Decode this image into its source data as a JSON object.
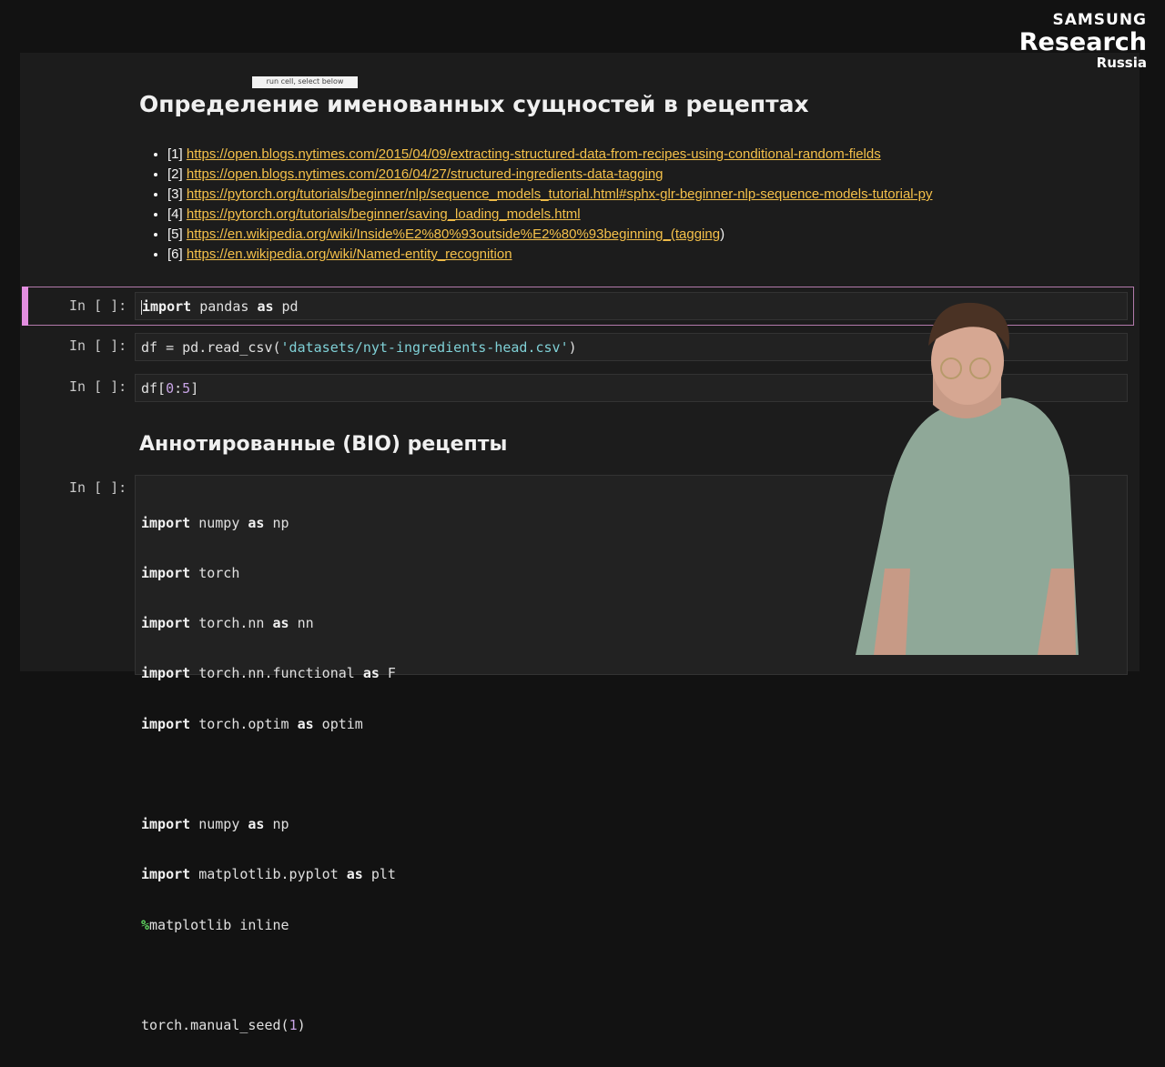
{
  "brand": {
    "line1": "SAMSUNG",
    "line2": "Research",
    "line3": "Russia"
  },
  "tooltip": "run cell, select below",
  "title": "Определение именованных сущностей в рецептах",
  "references": [
    {
      "num": "[1]",
      "url": "https://open.blogs.nytimes.com/2015/04/09/extracting-structured-data-from-recipes-using-conditional-random-fields",
      "suffix": ""
    },
    {
      "num": "[2]",
      "url": "https://open.blogs.nytimes.com/2016/04/27/structured-ingredients-data-tagging",
      "suffix": ""
    },
    {
      "num": "[3]",
      "url": "https://pytorch.org/tutorials/beginner/nlp/sequence_models_tutorial.html#sphx-glr-beginner-nlp-sequence-models-tutorial-py",
      "suffix": ""
    },
    {
      "num": "[4]",
      "url": "https://pytorch.org/tutorials/beginner/saving_loading_models.html",
      "suffix": ""
    },
    {
      "num": "[5]",
      "url": "https://en.wikipedia.org/wiki/Inside%E2%80%93outside%E2%80%93beginning_(tagging",
      "suffix": ")"
    },
    {
      "num": "[6]",
      "url": "https://en.wikipedia.org/wiki/Named-entity_recognition",
      "suffix": ""
    }
  ],
  "prompt": "In [ ]:",
  "cells": {
    "c1": {
      "kw1": "import",
      "mid": " pandas ",
      "kw2": "as",
      "end": " pd"
    },
    "c2": {
      "pre": "df = pd.read_csv(",
      "str": "'datasets/nyt-ingredients-head.csv'",
      "post": ")"
    },
    "c3": {
      "pre": "df[",
      "n1": "0",
      "colon": ":",
      "n2": "5",
      "post": "]"
    }
  },
  "subtitle": "Аннотированные (BIO) рецепты",
  "code_lines": [
    {
      "kw": "import",
      "a": " numpy ",
      "as": "as",
      "b": " np"
    },
    {
      "kw": "import",
      "a": " torch",
      "as": "",
      "b": ""
    },
    {
      "kw": "import",
      "a": " torch.nn ",
      "as": "as",
      "b": " nn"
    },
    {
      "kw": "import",
      "a": " torch.nn.functional ",
      "as": "as",
      "b": " F"
    },
    {
      "kw": "import",
      "a": " torch.optim ",
      "as": "as",
      "b": " optim"
    },
    {
      "kw": "",
      "a": "",
      "as": "",
      "b": ""
    },
    {
      "kw": "import",
      "a": " numpy ",
      "as": "as",
      "b": " np"
    },
    {
      "kw": "import",
      "a": " matplotlib.pyplot ",
      "as": "as",
      "b": " plt"
    },
    {
      "magic": "%",
      "a": "matplotlib inline"
    },
    {
      "kw": "",
      "a": "",
      "as": "",
      "b": ""
    },
    {
      "kw": "",
      "a": "torch.manual_seed(",
      "num": "1",
      "b": ")"
    }
  ]
}
